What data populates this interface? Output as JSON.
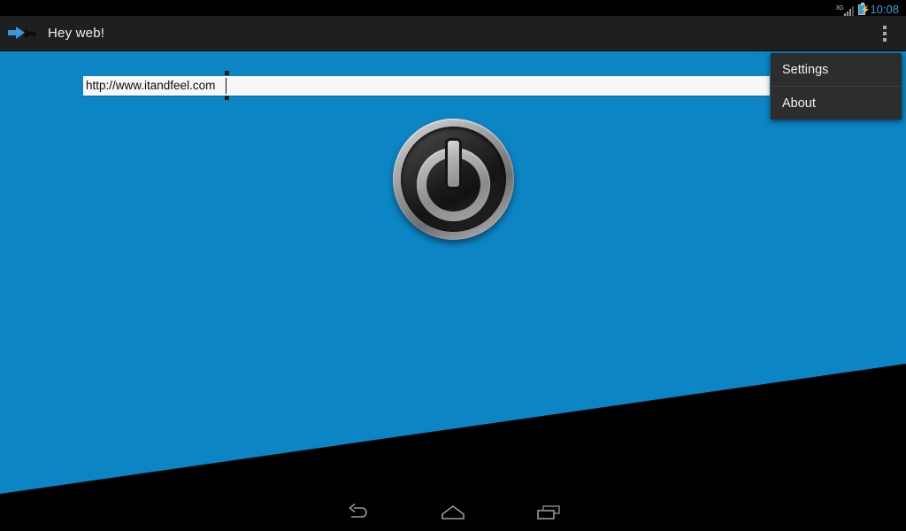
{
  "status_bar": {
    "network_label": "3G",
    "battery_icon": "battery-charging-icon",
    "signal_icon": "signal-bars-icon",
    "clock": "10:08",
    "clock_color": "#32a5d8"
  },
  "action_bar": {
    "app_icon": "exchange-arrows-icon",
    "title": "Hey web!",
    "overflow_icon": "overflow-dots-icon",
    "background": "#1f1f1f"
  },
  "overflow_menu": {
    "visible": true,
    "items": [
      {
        "label": "Settings"
      },
      {
        "label": "About"
      }
    ]
  },
  "content": {
    "background_color": "#0c85c4",
    "wedge_color": "#000000",
    "url_input": {
      "value": "http://www.itandfeel.com",
      "placeholder": "http://",
      "caret_visible": true
    },
    "power_button": {
      "icon": "power-button-icon",
      "label": ""
    }
  },
  "nav_bar": {
    "buttons": [
      {
        "name": "back-icon",
        "label": "Back"
      },
      {
        "name": "home-icon",
        "label": "Home"
      },
      {
        "name": "recents-icon",
        "label": "Recent apps"
      }
    ],
    "background": "#000000"
  }
}
